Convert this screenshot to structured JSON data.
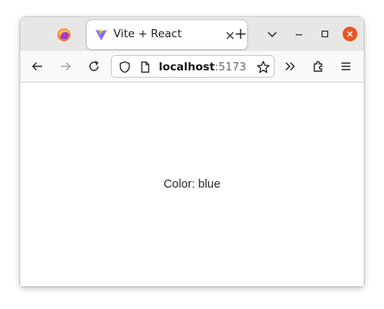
{
  "tab": {
    "title": "Vite + React"
  },
  "address_bar": {
    "host": "localhost",
    "port": ":5173"
  },
  "page": {
    "message": "Color: blue"
  },
  "icons": {
    "browser": "firefox-icon",
    "favicon": "vite-logo-icon",
    "tab_close": "close-icon",
    "new_tab": "plus-icon",
    "tab_list": "chevron-down-icon",
    "minimize": "minimize-icon",
    "maximize": "maximize-icon",
    "window_close": "window-close-icon",
    "back": "back-arrow-icon",
    "forward": "forward-arrow-icon",
    "reload": "reload-icon",
    "tracking_protection": "shield-icon",
    "page_info": "page-icon",
    "bookmark": "star-icon",
    "overflow": "double-chevron-icon",
    "extensions": "puzzle-icon",
    "menu": "hamburger-menu-icon"
  },
  "colors": {
    "window_close": "#e95420",
    "tab_bar": "#e8e7e5",
    "nav_bar": "#f9f9fb"
  }
}
